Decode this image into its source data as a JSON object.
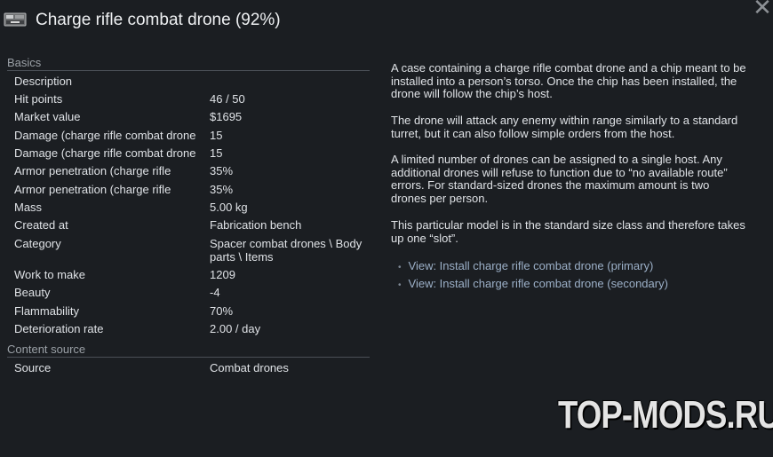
{
  "window": {
    "title": "Charge rifle combat drone (92%)",
    "icon": "combat-drone-icon",
    "close_icon": "close-icon"
  },
  "sections": [
    {
      "header": "Basics"
    },
    {
      "header": "Content source"
    }
  ],
  "basics": [
    {
      "label": "Description",
      "value": ""
    },
    {
      "label": "Hit points",
      "value": "46 / 50"
    },
    {
      "label": "Market value",
      "value": "$1695"
    },
    {
      "label": "Damage (charge rifle combat drone",
      "value": "15"
    },
    {
      "label": "Damage (charge rifle combat drone",
      "value": "15"
    },
    {
      "label": "Armor penetration (charge rifle",
      "value": "35%"
    },
    {
      "label": "Armor penetration (charge rifle",
      "value": "35%"
    },
    {
      "label": "Mass",
      "value": "5.00 kg"
    },
    {
      "label": "Created at",
      "value": "Fabrication bench"
    },
    {
      "label": "Category",
      "value": "Spacer combat drones \\ Body parts \\ Items"
    },
    {
      "label": "Work to make",
      "value": "1209"
    },
    {
      "label": "Beauty",
      "value": "-4"
    },
    {
      "label": "Flammability",
      "value": "70%"
    },
    {
      "label": "Deterioration rate",
      "value": "2.00 / day"
    }
  ],
  "content_source": [
    {
      "label": "Source",
      "value": "Combat drones"
    }
  ],
  "description": [
    "A case containing a charge rifle combat drone and a chip meant to be installed into a person’s torso. Once the chip has been installed, the drone will follow the chip’s host.",
    "The drone will attack any enemy within range similarly to a standard turret, but it can also follow simple orders from the host.",
    "A limited number of drones can be assigned to a single host. Any additional drones will refuse to function due to “no available route” errors. For standard-sized drones the maximum amount is two drones per person.",
    "This particular model is in the standard size class and therefore takes up one “slot”."
  ],
  "links": [
    "View: Install charge rifle combat drone (primary)",
    "View: Install charge rifle combat drone (secondary)"
  ],
  "watermark": "TOP-MODS.RU"
}
